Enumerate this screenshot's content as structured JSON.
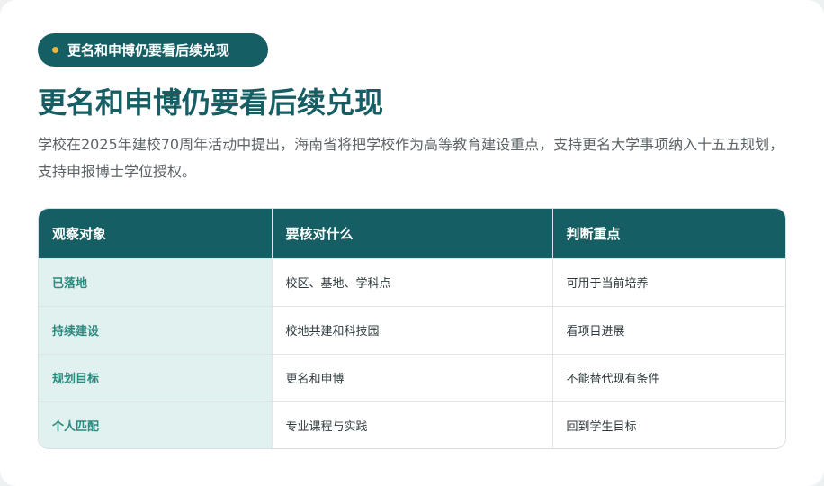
{
  "badge": {
    "text": "更名和申博仍要看后续兑现"
  },
  "heading": "更名和申博仍要看后续兑现",
  "description": "学校在2025年建校70周年活动中提出，海南省将把学校作为高等教育建设重点，支持更名大学事项纳入十五五规划，支持申报博士学位授权。",
  "table": {
    "headers": [
      "观察对象",
      "要核对什么",
      "判断重点"
    ],
    "rows": [
      [
        "已落地",
        "校区、基地、学科点",
        "可用于当前培养"
      ],
      [
        "持续建设",
        "校地共建和科技园",
        "看项目进展"
      ],
      [
        "规划目标",
        "更名和申博",
        "不能替代现有条件"
      ],
      [
        "个人匹配",
        "专业课程与实践",
        "回到学生目标"
      ]
    ]
  },
  "colors": {
    "primary": "#155e63",
    "accent_dot": "#f0b63c",
    "row_header_bg": "#e1f1ef",
    "row_header_text": "#2a8a7f"
  }
}
